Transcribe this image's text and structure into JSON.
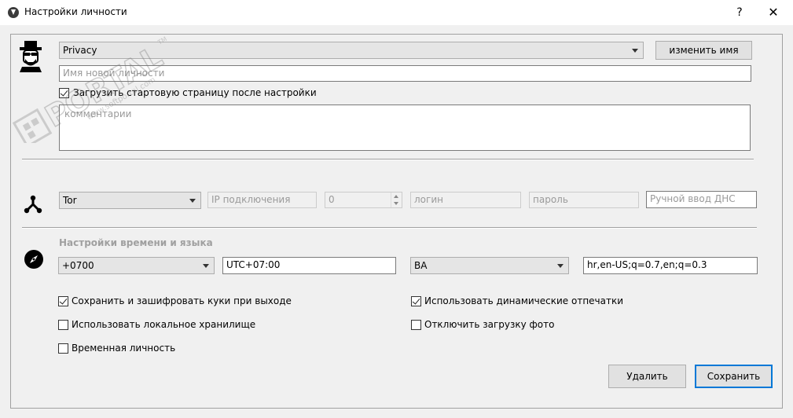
{
  "window": {
    "title": "Настройки личности",
    "help": "?",
    "close": "✕"
  },
  "profile": {
    "selected": "Privacy",
    "rename_button": "изменить имя",
    "name_placeholder": "Имя новой личности",
    "load_start_page_label": "Загрузить стартовую страницу после настройки",
    "load_start_page_checked": true,
    "comments_placeholder": "комментарии",
    "icon": "heisenberg-avatar-icon"
  },
  "network": {
    "icon": "network-node-icon",
    "proxy_type": "Tor",
    "ip_placeholder": "IP подключения",
    "port_value": "0",
    "login_placeholder": "логин",
    "password_placeholder": "пароль",
    "dns_placeholder": "Ручной ввод ДНС"
  },
  "locale": {
    "icon": "compass-icon",
    "section_title": "Настройки времени и языка",
    "timezone_offset": "+0700",
    "timezone_text": "UTC+07:00",
    "country": "BA",
    "languages": "hr,en-US;q=0.7,en;q=0.3"
  },
  "options": {
    "save_cookies": {
      "label": "Сохранить и зашифровать куки при выходе",
      "checked": true
    },
    "dynamic_fingerprints": {
      "label": "Использовать динамические отпечатки",
      "checked": true
    },
    "local_storage": {
      "label": "Использовать локальное хранилище",
      "checked": false
    },
    "disable_images": {
      "label": "Отключить загрузку фото",
      "checked": false
    },
    "temporary": {
      "label": "Временная личность",
      "checked": false
    }
  },
  "actions": {
    "delete": "Удалить",
    "save": "Сохранить"
  },
  "watermark": {
    "text": "PORTAL",
    "url": "www.softportal.com",
    "tm": "TM"
  }
}
